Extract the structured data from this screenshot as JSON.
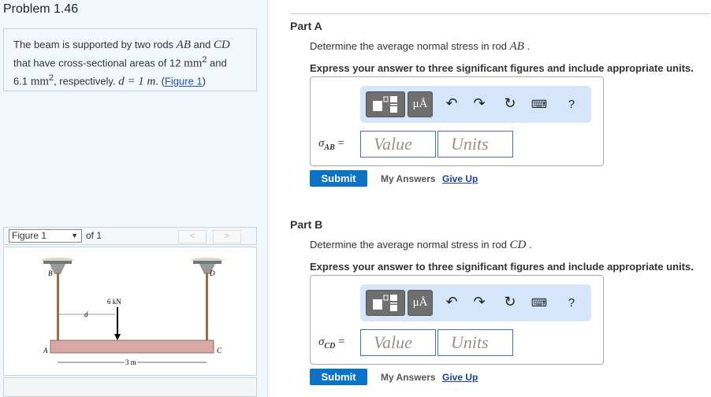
{
  "problem": {
    "title": "Problem 1.46",
    "text1": "The beam is supported by two rods ",
    "AB": "AB",
    "and": " and ",
    "CD": "CD",
    "text2": "that have cross-sectional areas of 12 ",
    "mm": "mm",
    "sq": "2",
    "text3": " and",
    "text4": "6.1 ",
    "text5": ", respectively. ",
    "deq": "d = 1 m",
    "period": ". (",
    "fig_link": "Figure 1",
    ")": ")"
  },
  "figure": {
    "select": "Figure 1",
    "of": "of 1",
    "prev": "<",
    "next": ">",
    "labels": {
      "B": "B",
      "D": "D",
      "A": "A",
      "C": "C",
      "load": "6 kN",
      "d": "d",
      "len": "3 m"
    }
  },
  "parts": [
    {
      "title": "Part A",
      "question": "Determine the average normal stress in rod ",
      "rod": "AB",
      "tail": " .",
      "instruction": "Express your answer to three significant figures and include appropriate units.",
      "sigma": "σ",
      "sub": "AB",
      "eq": " =",
      "value_ph": "Value",
      "units_ph": "Units",
      "submit": "Submit",
      "my_answers": "My Answers",
      "give_up": "Give Up"
    },
    {
      "title": "Part B",
      "question": "Determine the average normal stress in rod ",
      "rod": "CD",
      "tail": " .",
      "instruction": "Express your answer to three significant figures and include appropriate units.",
      "sigma": "σ",
      "sub": "CD",
      "eq": " =",
      "value_ph": "Value",
      "units_ph": "Units",
      "submit": "Submit",
      "my_answers": "My Answers",
      "give_up": "Give Up"
    }
  ],
  "toolbar": {
    "units_btn": "μÅ",
    "help": "?"
  }
}
